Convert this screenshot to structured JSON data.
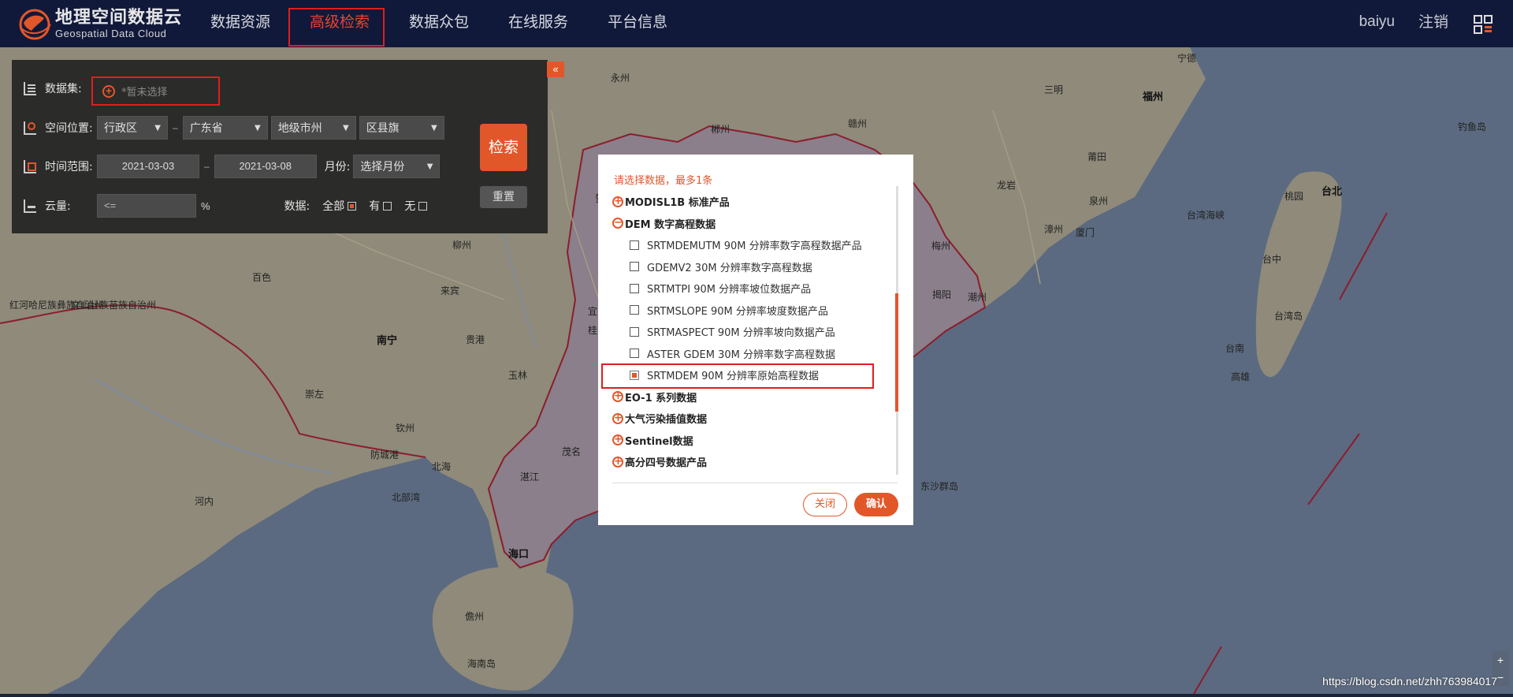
{
  "header": {
    "logo_cn": "地理空间数据云",
    "logo_en": "Geospatial Data Cloud",
    "nav": [
      "数据资源",
      "高级检索",
      "数据众包",
      "在线服务",
      "平台信息"
    ],
    "active_index": 1,
    "user": "baiyu",
    "logout": "注销"
  },
  "panel": {
    "collapse_symbol": "«",
    "dataset_label": "数据集:",
    "dataset_placeholder": "*暂未选择",
    "location_label": "空间位置:",
    "region_type": "行政区",
    "province": "广东省",
    "city": "地级市州",
    "county": "区县旗",
    "time_label": "时间范围:",
    "date_start": "2021-03-03",
    "date_end": "2021-03-08",
    "month_label": "月份:",
    "month_value": "选择月份",
    "cloud_label": "云量:",
    "cloud_placeholder": "<=",
    "percent": "%",
    "data_label": "数据:",
    "opt_all": "全部",
    "opt_has": "有",
    "opt_none": "无",
    "search_button": "检索",
    "reset_button": "重置"
  },
  "dialog": {
    "hint": "请选择数据，最多1条",
    "tree": [
      {
        "label": "MODISL1B 标准产品",
        "expanded": false
      },
      {
        "label": "DEM 数字高程数据",
        "expanded": true,
        "children": [
          {
            "label": "SRTMDEMUTM 90M 分辨率数字高程数据产品",
            "checked": false
          },
          {
            "label": "GDEMV2 30M 分辨率数字高程数据",
            "checked": false
          },
          {
            "label": "SRTMTPI 90M 分辨率坡位数据产品",
            "checked": false
          },
          {
            "label": "SRTMSLOPE 90M 分辨率坡度数据产品",
            "checked": false
          },
          {
            "label": "SRTMASPECT 90M 分辨率坡向数据产品",
            "checked": false
          },
          {
            "label": "ASTER GDEM 30M 分辨率数字高程数据",
            "checked": false
          },
          {
            "label": "SRTMDEM 90M 分辨率原始高程数据",
            "checked": true
          }
        ]
      },
      {
        "label": "EO-1 系列数据",
        "expanded": false
      },
      {
        "label": "大气污染插值数据",
        "expanded": false
      },
      {
        "label": "Sentinel数据",
        "expanded": false
      },
      {
        "label": "高分四号数据产品",
        "expanded": false
      }
    ],
    "close_button": "关闭",
    "confirm_button": "确认"
  },
  "map": {
    "labels": [
      {
        "text": "福州",
        "big": true
      },
      {
        "text": "台北",
        "big": true
      },
      {
        "text": "南宁",
        "big": true
      },
      {
        "text": "海口",
        "big": true
      },
      {
        "text": "宁德"
      },
      {
        "text": "三明"
      },
      {
        "text": "莆田"
      },
      {
        "text": "泉州"
      },
      {
        "text": "漳州"
      },
      {
        "text": "厦门"
      },
      {
        "text": "龙岩"
      },
      {
        "text": "梅州"
      },
      {
        "text": "揭阳"
      },
      {
        "text": "潮州"
      },
      {
        "text": "赣州"
      },
      {
        "text": "郴州"
      },
      {
        "text": "永州"
      },
      {
        "text": "贺州"
      },
      {
        "text": "柳州"
      },
      {
        "text": "来宾"
      },
      {
        "text": "贵港"
      },
      {
        "text": "玉林"
      },
      {
        "text": "钦州"
      },
      {
        "text": "北海"
      },
      {
        "text": "防城港"
      },
      {
        "text": "崇左"
      },
      {
        "text": "百色"
      },
      {
        "text": "茂名"
      },
      {
        "text": "湛江"
      },
      {
        "text": "儋州"
      },
      {
        "text": "海南岛"
      },
      {
        "text": "北部湾"
      },
      {
        "text": "河内"
      },
      {
        "text": "桃园"
      },
      {
        "text": "台中"
      },
      {
        "text": "台湾岛"
      },
      {
        "text": "台南"
      },
      {
        "text": "高雄"
      },
      {
        "text": "台湾海峡"
      },
      {
        "text": "钓鱼岛"
      },
      {
        "text": "东沙群岛"
      },
      {
        "text": "红河哈尼族彝族自治州"
      },
      {
        "text": "文山壮族苗族自治州"
      },
      {
        "text": "宜"
      },
      {
        "text": "桂"
      }
    ],
    "zoom_in": "+",
    "zoom_out": "−"
  },
  "watermark": "https://blog.csdn.net/zhh763984017"
}
